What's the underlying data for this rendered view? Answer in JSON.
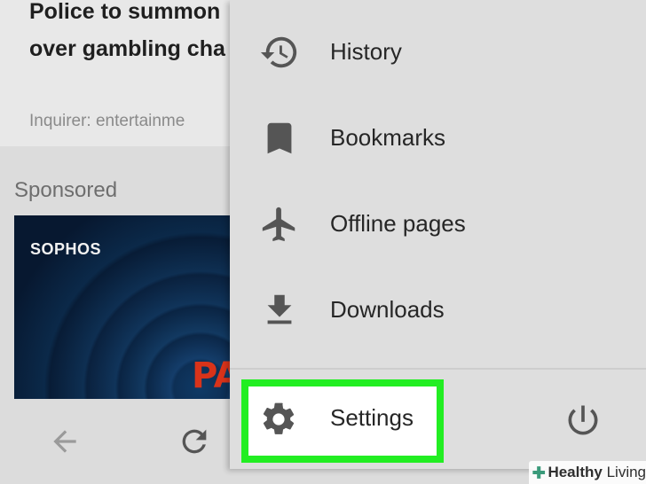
{
  "background_page": {
    "news_title_line1": "Police to summon",
    "news_title_line2": "over gambling cha",
    "news_source": "Inquirer: entertainme",
    "sponsored_label": "Sponsored",
    "ad_brand": "SOPHOS",
    "ad_promo_fragment": "PA"
  },
  "bottom_bar": {
    "back_icon": "arrow-left-icon",
    "refresh_icon": "refresh-icon"
  },
  "menu": {
    "items": [
      {
        "label": "History",
        "icon": "history-icon"
      },
      {
        "label": "Bookmarks",
        "icon": "bookmark-icon"
      },
      {
        "label": "Offline pages",
        "icon": "airplane-icon"
      },
      {
        "label": "Downloads",
        "icon": "download-icon"
      }
    ],
    "settings": {
      "label": "Settings",
      "icon": "gear-icon",
      "highlighted": true
    },
    "power_icon": "power-icon"
  },
  "colors": {
    "highlight": "#22ee22",
    "icon": "#555555",
    "menu_bg": "#dedede"
  },
  "watermark": {
    "brand_bold": "Healthy",
    "brand_regular": " Living"
  }
}
